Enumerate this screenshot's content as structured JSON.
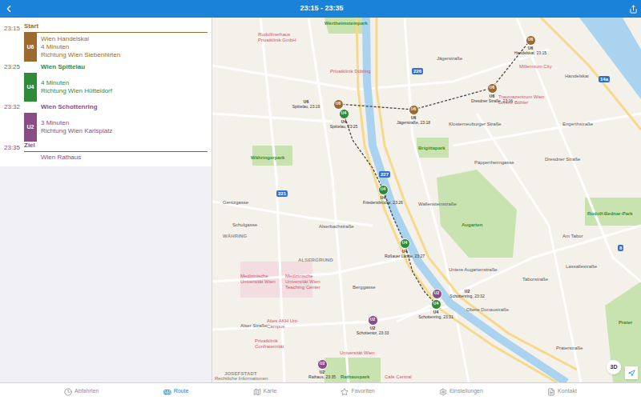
{
  "window": {
    "title": "23:15 - 23:35"
  },
  "itinerary": [
    {
      "kind": "header",
      "time": "23:15",
      "text": "Start",
      "color": "#9c6a2e"
    },
    {
      "kind": "leg",
      "line": "U6",
      "color": "#9c6a2e",
      "lines": [
        "Wien Handelskai",
        "4 Minuten",
        "Richtung Wien Siebenhirten"
      ]
    },
    {
      "kind": "stop",
      "time": "23:25",
      "text": "Wien Spittelau",
      "color": "#2f8a3a"
    },
    {
      "kind": "leg",
      "line": "U4",
      "color": "#2f8a3a",
      "lines": [
        "4 Minuten",
        "Richtung Wien Hütteldorf"
      ]
    },
    {
      "kind": "stop",
      "time": "23:32",
      "text": "Wien Schottenring",
      "color": "#8a4c86"
    },
    {
      "kind": "leg",
      "line": "U2",
      "color": "#8a4c86",
      "lines": [
        "3 Minuten",
        "Richtung Wien Karlsplatz"
      ]
    },
    {
      "kind": "header",
      "time": "23:35",
      "text": "Ziel",
      "color": "#8a4c86"
    },
    {
      "kind": "place",
      "text": "Wien Rathaus",
      "color": "#8a4c86"
    }
  ],
  "map": {
    "stops": [
      {
        "badge": "U6",
        "line": "U6",
        "caption": "Handelskai, 23:15",
        "color": "#9c6a2e"
      },
      {
        "badge": "U6",
        "line": "U6",
        "caption": "Dresdner Straße, 23:16",
        "color": "#9c6a2e"
      },
      {
        "badge": "U6",
        "line": "U6",
        "caption": "Jägerstraße, 23:18",
        "color": "#9c6a2e"
      },
      {
        "badge": "U6",
        "line": "U6",
        "caption": "Spittelau, 23:19",
        "color": "#9c6a2e"
      },
      {
        "badge": "U4",
        "line": "U4",
        "caption": "Spittelau, 23:25",
        "color": "#2f8a3a"
      },
      {
        "badge": "U4",
        "line": "U4",
        "caption": "Friedensbrücke, 23:26",
        "color": "#2f8a3a"
      },
      {
        "badge": "U4",
        "line": "U4",
        "caption": "Roßauer Lände, 23:27",
        "color": "#2f8a3a"
      },
      {
        "badge": "U2",
        "line": "U2",
        "caption": "Schottenring, 23:32",
        "color": "#8a4c86"
      },
      {
        "badge": "U4",
        "line": "U4",
        "caption": "Schottenring, 23:31",
        "color": "#2f8a3a"
      },
      {
        "badge": "U2",
        "line": "U2",
        "caption": "Schottentor, 23:33",
        "color": "#8a4c86"
      },
      {
        "badge": "U2",
        "line": "U2",
        "caption": "Rathaus, 23:35",
        "color": "#8a4c86"
      }
    ],
    "labels": [
      {
        "text": "Wertheimsteinpark",
        "kind": "park"
      },
      {
        "text": "Rudolfinerhaus Privatklinik GmbH",
        "kind": "poi"
      },
      {
        "text": "Privatklinik Döbling",
        "kind": "poi"
      },
      {
        "text": "Millennium City",
        "kind": "poi"
      },
      {
        "text": "Traumazentrum Wien Lorenz Böhler",
        "kind": "poi"
      },
      {
        "text": "Brigittapark",
        "kind": "park"
      },
      {
        "text": "Augarten",
        "kind": "park"
      },
      {
        "text": "Rudolf-Bednar-Park",
        "kind": "park"
      },
      {
        "text": "Währingerpark",
        "kind": "park"
      },
      {
        "text": "WÄHRING",
        "kind": "district"
      },
      {
        "text": "ALSERGRUND",
        "kind": "district"
      },
      {
        "text": "Medizinische Universität Wien",
        "kind": "poi"
      },
      {
        "text": "Medizinische Universität Wien Teaching Center",
        "kind": "poi"
      },
      {
        "text": "Altes AKH Uni-Campus",
        "kind": "poi"
      },
      {
        "text": "Privatklinik Confraternität",
        "kind": "poi"
      },
      {
        "text": "Universität Wien",
        "kind": "poi"
      },
      {
        "text": "Rathauspark",
        "kind": "park"
      },
      {
        "text": "Café Central",
        "kind": "poi"
      },
      {
        "text": "Prater",
        "kind": "park"
      },
      {
        "text": "JOSEFSTADT",
        "kind": "district"
      },
      {
        "text": "Gentzgasse",
        "kind": "street"
      },
      {
        "text": "Schulgasse",
        "kind": "street"
      },
      {
        "text": "Alser Straße",
        "kind": "street"
      },
      {
        "text": "Alserbachstraße",
        "kind": "street"
      },
      {
        "text": "Berggasse",
        "kind": "street"
      },
      {
        "text": "Wallensteinstraße",
        "kind": "street"
      },
      {
        "text": "Klosterneuburger Straße",
        "kind": "street"
      },
      {
        "text": "Dresdner Straße",
        "kind": "street"
      },
      {
        "text": "Engerthstraße",
        "kind": "street"
      },
      {
        "text": "Lassallestraße",
        "kind": "street"
      },
      {
        "text": "Taborstraße",
        "kind": "street"
      },
      {
        "text": "Obere Donaustraße",
        "kind": "street"
      },
      {
        "text": "Untere Augartenstraße",
        "kind": "street"
      },
      {
        "text": "Am Tabor",
        "kind": "street"
      },
      {
        "text": "Praterstraße",
        "kind": "street"
      },
      {
        "text": "Pappenheimgasse",
        "kind": "street"
      },
      {
        "text": "Jägerstraße",
        "kind": "street"
      },
      {
        "text": "Handelskai",
        "kind": "street"
      },
      {
        "text": "Rechtliche Informationen",
        "kind": "legal"
      }
    ],
    "shields": [
      "226",
      "227",
      "221",
      "14a",
      "8"
    ],
    "button_3d": "3D"
  },
  "tabs": [
    {
      "label": "Abfahrten",
      "selected": false
    },
    {
      "label": "Route",
      "selected": true
    },
    {
      "label": "Karte",
      "selected": false
    },
    {
      "label": "Favoriten",
      "selected": false
    },
    {
      "label": "Einstellungen",
      "selected": false
    },
    {
      "label": "Kontakt",
      "selected": false
    }
  ]
}
